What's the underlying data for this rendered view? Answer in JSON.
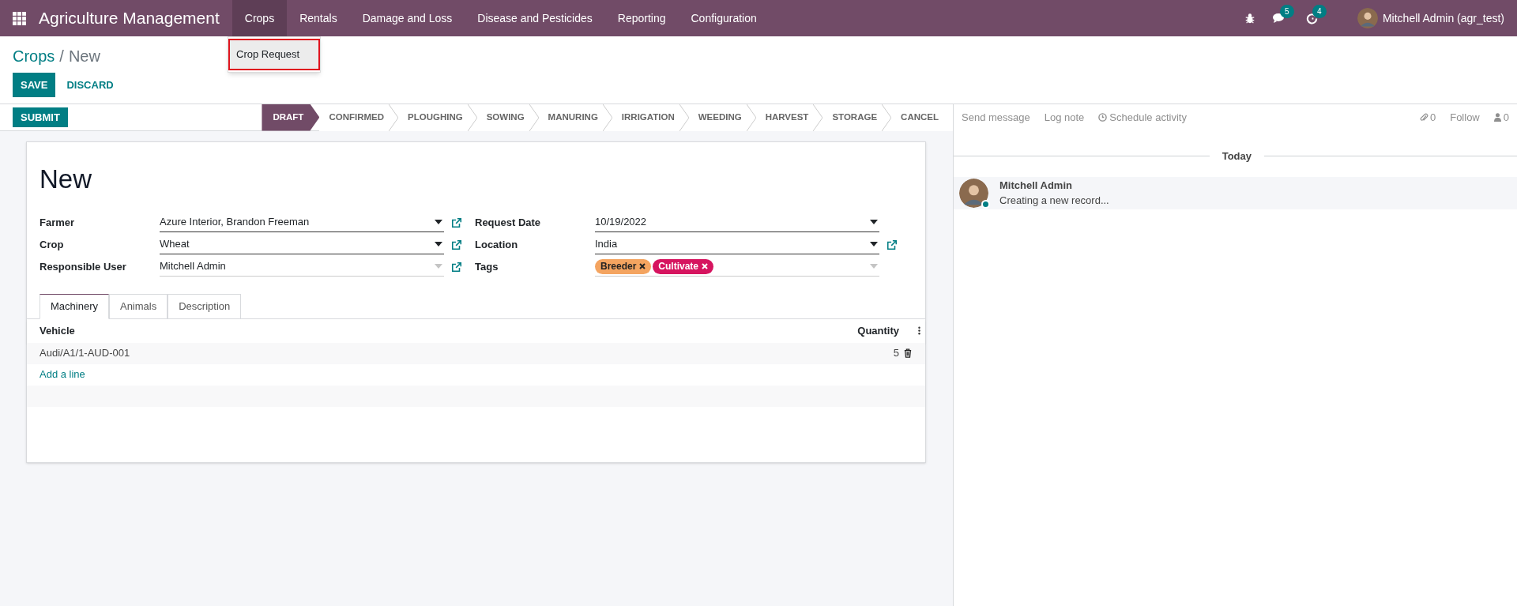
{
  "navbar": {
    "app_title": "Agriculture Management",
    "menu": [
      {
        "label": "Crops",
        "selected": true
      },
      {
        "label": "Rentals",
        "selected": false
      },
      {
        "label": "Damage and Loss",
        "selected": false
      },
      {
        "label": "Disease and Pesticides",
        "selected": false
      },
      {
        "label": "Reporting",
        "selected": false
      },
      {
        "label": "Configuration",
        "selected": false
      }
    ],
    "chat_count": "5",
    "activity_count": "4",
    "user": "Mitchell Admin (agr_test)"
  },
  "dropdown": {
    "items": [
      {
        "label": "Crop Request",
        "highlighted": true
      }
    ]
  },
  "breadcrumb": {
    "parent": "Crops",
    "separator": "/",
    "current": "New"
  },
  "buttons": {
    "save": "SAVE",
    "discard": "DISCARD"
  },
  "submit": "SUBMIT",
  "stages": [
    {
      "label": "DRAFT",
      "selected": true
    },
    {
      "label": "CONFIRMED",
      "selected": false
    },
    {
      "label": "PLOUGHING",
      "selected": false
    },
    {
      "label": "SOWING",
      "selected": false
    },
    {
      "label": "MANURING",
      "selected": false
    },
    {
      "label": "IRRIGATION",
      "selected": false
    },
    {
      "label": "WEEDING",
      "selected": false
    },
    {
      "label": "HARVEST",
      "selected": false
    },
    {
      "label": "STORAGE",
      "selected": false
    },
    {
      "label": "CANCEL",
      "selected": false
    }
  ],
  "form": {
    "title": "New",
    "left_fields": [
      {
        "label": "Farmer",
        "value": "Azure Interior, Brandon Freeman",
        "caret_dim": false,
        "external_link": true
      },
      {
        "label": "Crop",
        "value": "Wheat",
        "caret_dim": false,
        "external_link": true
      },
      {
        "label": "Responsible User",
        "value": "Mitchell Admin",
        "caret_dim": true,
        "external_link": true
      }
    ],
    "right_fields": [
      {
        "label": "Request Date",
        "value": "10/19/2022",
        "caret_dim": false,
        "external_link": false
      },
      {
        "label": "Location",
        "value": "India",
        "caret_dim": false,
        "external_link": true
      },
      {
        "label": "Tags",
        "tags": [
          {
            "label": "Breeder",
            "color": "#f4a460"
          },
          {
            "label": "Cultivate",
            "color": "#d6145f"
          }
        ],
        "caret_dim": true,
        "external_link": false
      }
    ],
    "tabs": [
      {
        "label": "Machinery",
        "selected": true
      },
      {
        "label": "Animals",
        "selected": false
      },
      {
        "label": "Description",
        "selected": false
      }
    ],
    "table": {
      "columns": [
        "Vehicle",
        "Quantity"
      ],
      "rows": [
        {
          "vehicle": "Audi/A1/1-AUD-001",
          "quantity": "5"
        }
      ],
      "add_line": "Add a line"
    }
  },
  "chatter": {
    "send_message": "Send message",
    "log_note": "Log note",
    "schedule_activity": "Schedule activity",
    "attachments": "0",
    "follow": "Follow",
    "followers": "0",
    "date_separator": "Today",
    "messages": [
      {
        "author": "Mitchell Admin",
        "body": "Creating a new record...",
        "online": true
      }
    ]
  }
}
